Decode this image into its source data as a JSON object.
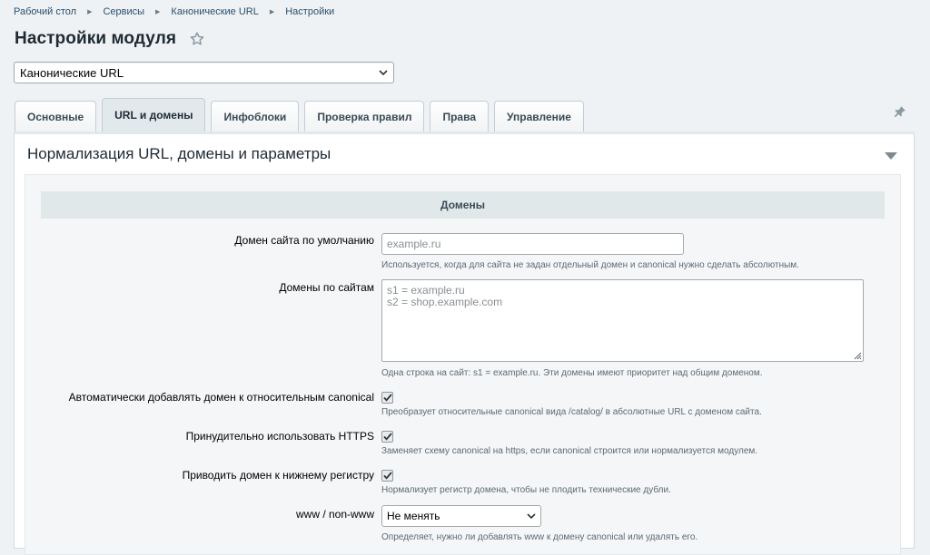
{
  "breadcrumb": [
    "Рабочий стол",
    "Сервисы",
    "Канонические URL",
    "Настройки"
  ],
  "page": {
    "title": "Настройки модуля"
  },
  "module_select": {
    "value": "Канонические URL"
  },
  "tabs": [
    {
      "label": "Основные",
      "active": false
    },
    {
      "label": "URL и домены",
      "active": true
    },
    {
      "label": "Инфоблоки",
      "active": false
    },
    {
      "label": "Проверка правил",
      "active": false
    },
    {
      "label": "Права",
      "active": false
    },
    {
      "label": "Управление",
      "active": false
    }
  ],
  "panel": {
    "title": "Нормализация URL, домены и параметры",
    "section": "Домены",
    "fields": {
      "default_domain": {
        "label": "Домен сайта по умолчанию",
        "placeholder": "example.ru",
        "hint": "Используется, когда для сайта не задан отдельный домен и canonical нужно сделать абсолютным."
      },
      "site_domains": {
        "label": "Домены по сайтам",
        "placeholder": "s1 = example.ru\ns2 = shop.example.com",
        "hint": "Одна строка на сайт: s1 = example.ru. Эти домены имеют приоритет над общим доменом."
      },
      "auto_domain": {
        "label": "Автоматически добавлять домен к относительным canonical",
        "checked": true,
        "hint": "Преобразует относительные canonical вида /catalog/ в абсолютные URL с доменом сайта."
      },
      "force_https": {
        "label": "Принудительно использовать HTTPS",
        "checked": true,
        "hint": "Заменяет схему canonical на https, если canonical строится или нормализуется модулем."
      },
      "lowercase": {
        "label": "Приводить домен к нижнему регистру",
        "checked": true,
        "hint": "Нормализует регистр домена, чтобы не плодить технические дубли."
      },
      "www": {
        "label": "www / non-www",
        "value": "Не менять",
        "hint": "Определяет, нужно ли добавлять www к домену canonical или удалять его."
      }
    }
  },
  "colors": {
    "background": "#eef2f4",
    "tab_active": "#e1e9ec",
    "section_head": "#e0e8ea",
    "link": "#2b4f6e"
  },
  "icons": [
    "star-icon",
    "chevron-down-icon",
    "pin-icon",
    "collapse-triangle-icon",
    "checkmark-icon",
    "resize-handle-icon"
  ]
}
